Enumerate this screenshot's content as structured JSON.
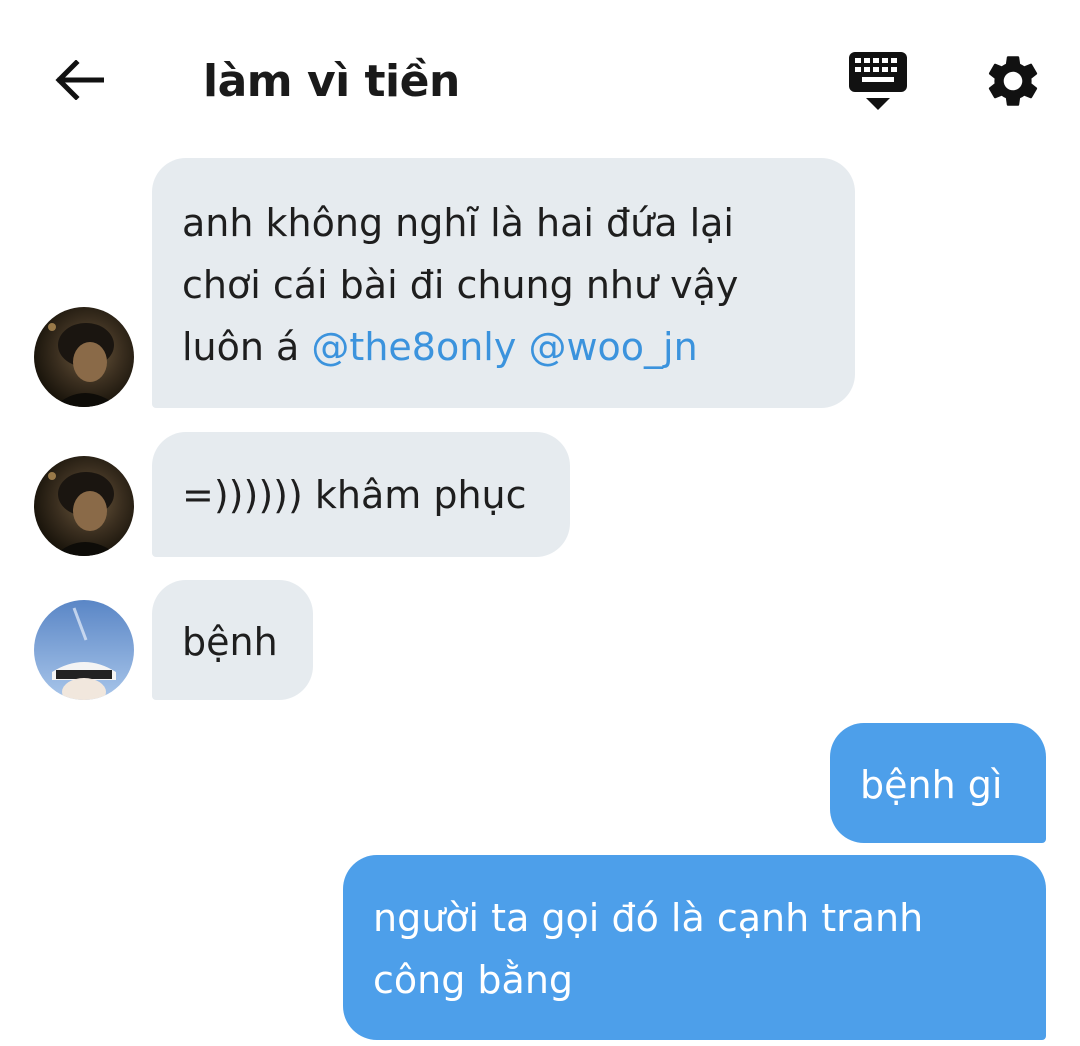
{
  "header": {
    "title": "làm vì tiền",
    "back_icon": "arrow-left-icon",
    "keyboard_icon": "keyboard-hide-icon",
    "settings_icon": "gear-icon"
  },
  "messages": [
    {
      "direction": "incoming",
      "avatar": "avatar-dark-photo",
      "lines": [
        "anh không nghĩ là hai đứa lại",
        "chơi cái bài đi chung như vậy"
      ],
      "last_line_text": "luôn á ",
      "mentions": [
        "@the8only",
        "@woo_jn"
      ]
    },
    {
      "direction": "incoming",
      "avatar": "avatar-dark-photo",
      "text": "=)))))) khâm phục"
    },
    {
      "direction": "incoming",
      "avatar": "avatar-sky-photo",
      "text": "bệnh"
    },
    {
      "direction": "outgoing",
      "text": "bệnh gì"
    },
    {
      "direction": "outgoing",
      "lines": [
        "người ta gọi đó là cạnh tranh",
        "công bằng"
      ]
    }
  ],
  "colors": {
    "incoming_bubble": "#e6ebef",
    "outgoing_bubble": "#4d9fea",
    "mention": "#3b93dd",
    "background": "#ffffff"
  }
}
